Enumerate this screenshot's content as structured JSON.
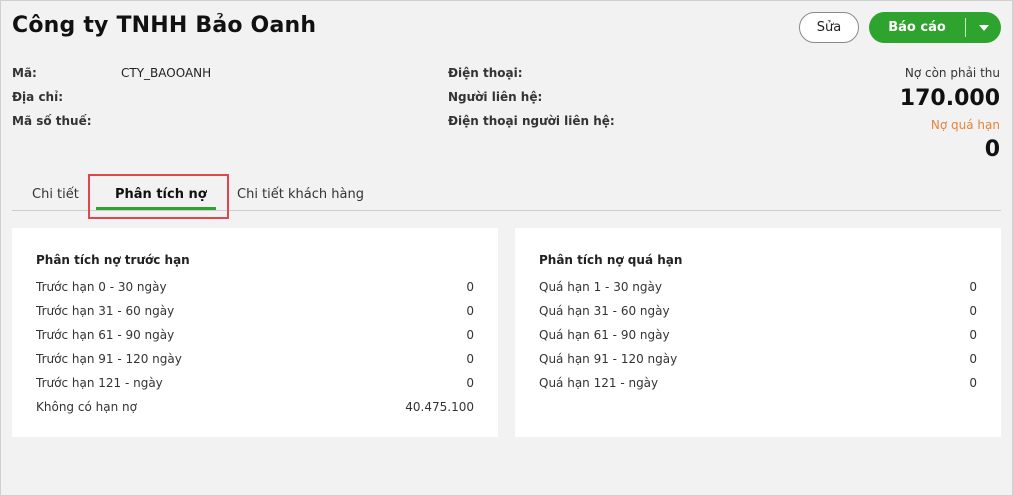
{
  "header": {
    "title": "Công ty TNHH Bảo Oanh",
    "edit_label": "Sửa",
    "report_label": "Báo cáo"
  },
  "info": {
    "code_label": "Mã:",
    "code_value": "CTY_BAOOANH",
    "address_label": "Địa chỉ:",
    "tax_label": "Mã số thuế:",
    "phone_label": "Điện thoại:",
    "contact_label": "Người liên hệ:",
    "contact_phone_label": "Điện thoại người liên hệ:"
  },
  "summary": {
    "debt_label": "Nợ còn phải thu",
    "debt_value": "170.000",
    "overdue_label": "Nợ quá hạn",
    "overdue_value": "0"
  },
  "tabs": [
    {
      "label": "Chi tiết",
      "active": false
    },
    {
      "label": "Phân tích nợ",
      "active": true
    },
    {
      "label": "Chi tiết khách hàng",
      "active": false
    }
  ],
  "before_due": {
    "title": "Phân tích nợ trước hạn",
    "rows": [
      {
        "label": "Trước hạn 0 - 30 ngày",
        "value": "0"
      },
      {
        "label": "Trước hạn 31 - 60 ngày",
        "value": "0"
      },
      {
        "label": "Trước hạn 61 - 90 ngày",
        "value": "0"
      },
      {
        "label": "Trước hạn 91 - 120 ngày",
        "value": "0"
      },
      {
        "label": "Trước hạn 121 - ngày",
        "value": "0"
      },
      {
        "label": "Không có hạn nợ",
        "value": "40.475.100"
      }
    ]
  },
  "overdue": {
    "title": "Phân tích nợ quá hạn",
    "rows": [
      {
        "label": "Quá hạn 1 - 30 ngày",
        "value": "0"
      },
      {
        "label": "Quá hạn 31 - 60 ngày",
        "value": "0"
      },
      {
        "label": "Quá hạn 61 - 90 ngày",
        "value": "0"
      },
      {
        "label": "Quá hạn 91 - 120 ngày",
        "value": "0"
      },
      {
        "label": "Quá hạn 121 - ngày",
        "value": "0"
      }
    ]
  },
  "colors": {
    "accent": "#2ea32e",
    "overdue_text": "#e8833a",
    "highlight": "#e0474c"
  }
}
